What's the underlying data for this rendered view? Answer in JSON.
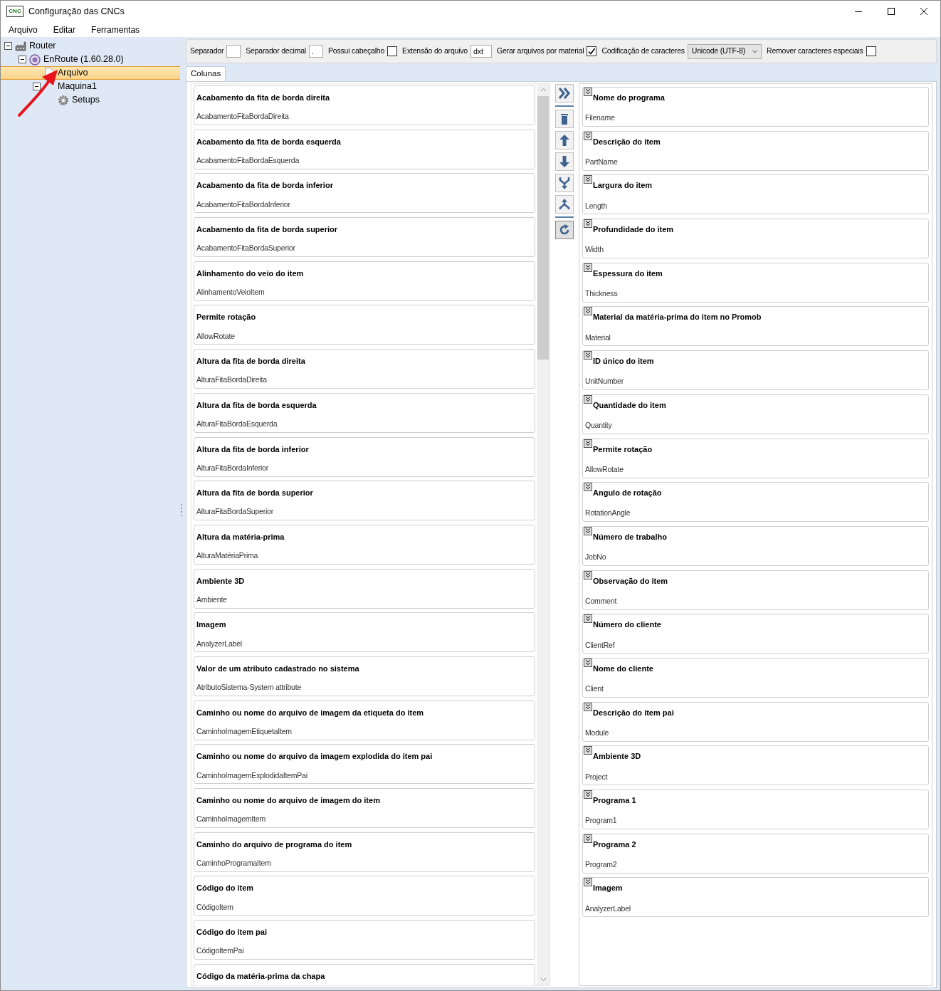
{
  "window": {
    "title": "Configuração das CNCs",
    "icon_label": "CNC"
  },
  "menu": [
    "Arquivo",
    "Editar",
    "Ferramentas"
  ],
  "tree": [
    {
      "label": "Router",
      "kind": "router",
      "expanded": true,
      "selected": false,
      "children": [
        {
          "label": "EnRoute (1.60.28.0)",
          "kind": "software",
          "expanded": true,
          "selected": false,
          "children": [
            {
              "label": "Arquivo",
              "kind": "file",
              "selected": true
            },
            {
              "label": "Maquina1",
              "kind": "machine",
              "expanded": true,
              "selected": false,
              "children": [
                {
                  "label": "Setups",
                  "kind": "setup",
                  "selected": false
                }
              ]
            }
          ]
        }
      ]
    }
  ],
  "options": [
    {
      "kind": "text",
      "label": "Separador"
    },
    {
      "kind": "text",
      "label": "Separador decimal",
      "value": "."
    },
    {
      "kind": "checkbox",
      "label": "Possui cabeçalho",
      "checked": false
    },
    {
      "kind": "text",
      "label": "Extensão do arquivo",
      "value": "dxt"
    },
    {
      "kind": "checkbox",
      "label": "Gerar arquivos por material",
      "checked": true
    },
    {
      "kind": "select",
      "label": "Codificação de caracteres",
      "value": "Unicode (UTF-8)"
    },
    {
      "kind": "checkbox",
      "label": "Remover caracteres especiais",
      "checked": false
    }
  ],
  "tabs": [
    {
      "label": "Colunas",
      "selected": true
    }
  ],
  "available_columns": [
    {
      "title": "Acabamento da fita de borda direita",
      "field": "AcabamentoFitaBordaDireita"
    },
    {
      "title": "Acabamento da fita de borda esquerda",
      "field": "AcabamentoFitaBordaEsquerda"
    },
    {
      "title": "Acabamento da fita de borda inferior",
      "field": "AcabamentoFitaBordaInferior"
    },
    {
      "title": "Acabamento da fita de borda superior",
      "field": "AcabamentoFitaBordaSuperior"
    },
    {
      "title": "Alinhamento do veio do item",
      "field": "AlinhamentoVeioItem"
    },
    {
      "title": "Permite rotação",
      "field": "AllowRotate"
    },
    {
      "title": "Altura da fita de borda direita",
      "field": "AlturaFitaBordaDireita"
    },
    {
      "title": "Altura da fita de borda esquerda",
      "field": "AlturaFitaBordaEsquerda"
    },
    {
      "title": "Altura da fita de borda inferior",
      "field": "AlturaFitaBordaInferior"
    },
    {
      "title": "Altura da fita de borda superior",
      "field": "AlturaFitaBordaSuperior"
    },
    {
      "title": "Altura da matéria-prima",
      "field": "AlturaMatériaPrima"
    },
    {
      "title": "Ambiente 3D",
      "field": "Ambiente"
    },
    {
      "title": "Imagem",
      "field": "AnalyzerLabel"
    },
    {
      "title": "Valor de um atributo cadastrado no sistema",
      "field": "AtributoSistema-System attribute"
    },
    {
      "title": "Caminho ou nome do arquivo de imagem da etiqueta do item",
      "field": "CaminhoImagemEtiquetaItem"
    },
    {
      "title": "Caminho ou nome do arquivo da imagem explodida do item pai",
      "field": "CaminhoImagemExplodidaItemPai"
    },
    {
      "title": "Caminho ou nome do arquivo de imagem do item",
      "field": "CaminhoImagemItem"
    },
    {
      "title": "Caminho do arquivo de programa do item",
      "field": "CaminhoProgramaItem"
    },
    {
      "title": "Código do item",
      "field": "CódigoItem"
    },
    {
      "title": "Código do item pai",
      "field": "CódigoItemPai"
    },
    {
      "title": "Código da matéria-prima da chapa"
    }
  ],
  "actions": [
    {
      "kind": "add_all"
    },
    {
      "kind": "separator"
    },
    {
      "kind": "delete"
    },
    {
      "kind": "up"
    },
    {
      "kind": "down"
    },
    {
      "kind": "merge"
    },
    {
      "kind": "split"
    },
    {
      "kind": "separator"
    },
    {
      "kind": "refresh"
    }
  ],
  "selected_columns": [
    {
      "title": "Nome do programa",
      "field": "Filename"
    },
    {
      "title": "Descrição do item",
      "field": "PartName"
    },
    {
      "title": "Largura do item",
      "field": "Length"
    },
    {
      "title": "Profundidade do item",
      "field": "Width"
    },
    {
      "title": "Espessura do item",
      "field": "Thickness"
    },
    {
      "title": "Material da matéria-prima do item no Promob",
      "field": "Material"
    },
    {
      "title": "ID único do item",
      "field": "UnitNumber"
    },
    {
      "title": "Quantidade do item",
      "field": "Quantity"
    },
    {
      "title": "Permite rotação",
      "field": "AllowRotate"
    },
    {
      "title": "Angulo de rotação",
      "field": "RotationAngle"
    },
    {
      "title": "Número de trabalho",
      "field": "JobNo"
    },
    {
      "title": "Observação do item",
      "field": "Comment"
    },
    {
      "title": "Número do cliente",
      "field": "ClientRef"
    },
    {
      "title": "Nome do cliente",
      "field": "Client"
    },
    {
      "title": "Descrição do item pai",
      "field": "Module"
    },
    {
      "title": "Ambiente 3D",
      "field": "Project"
    },
    {
      "title": "Programa 1",
      "field": "Program1"
    },
    {
      "title": "Programa 2",
      "field": "Program2"
    },
    {
      "title": "Imagem",
      "field": "AnalyzerLabel"
    }
  ]
}
